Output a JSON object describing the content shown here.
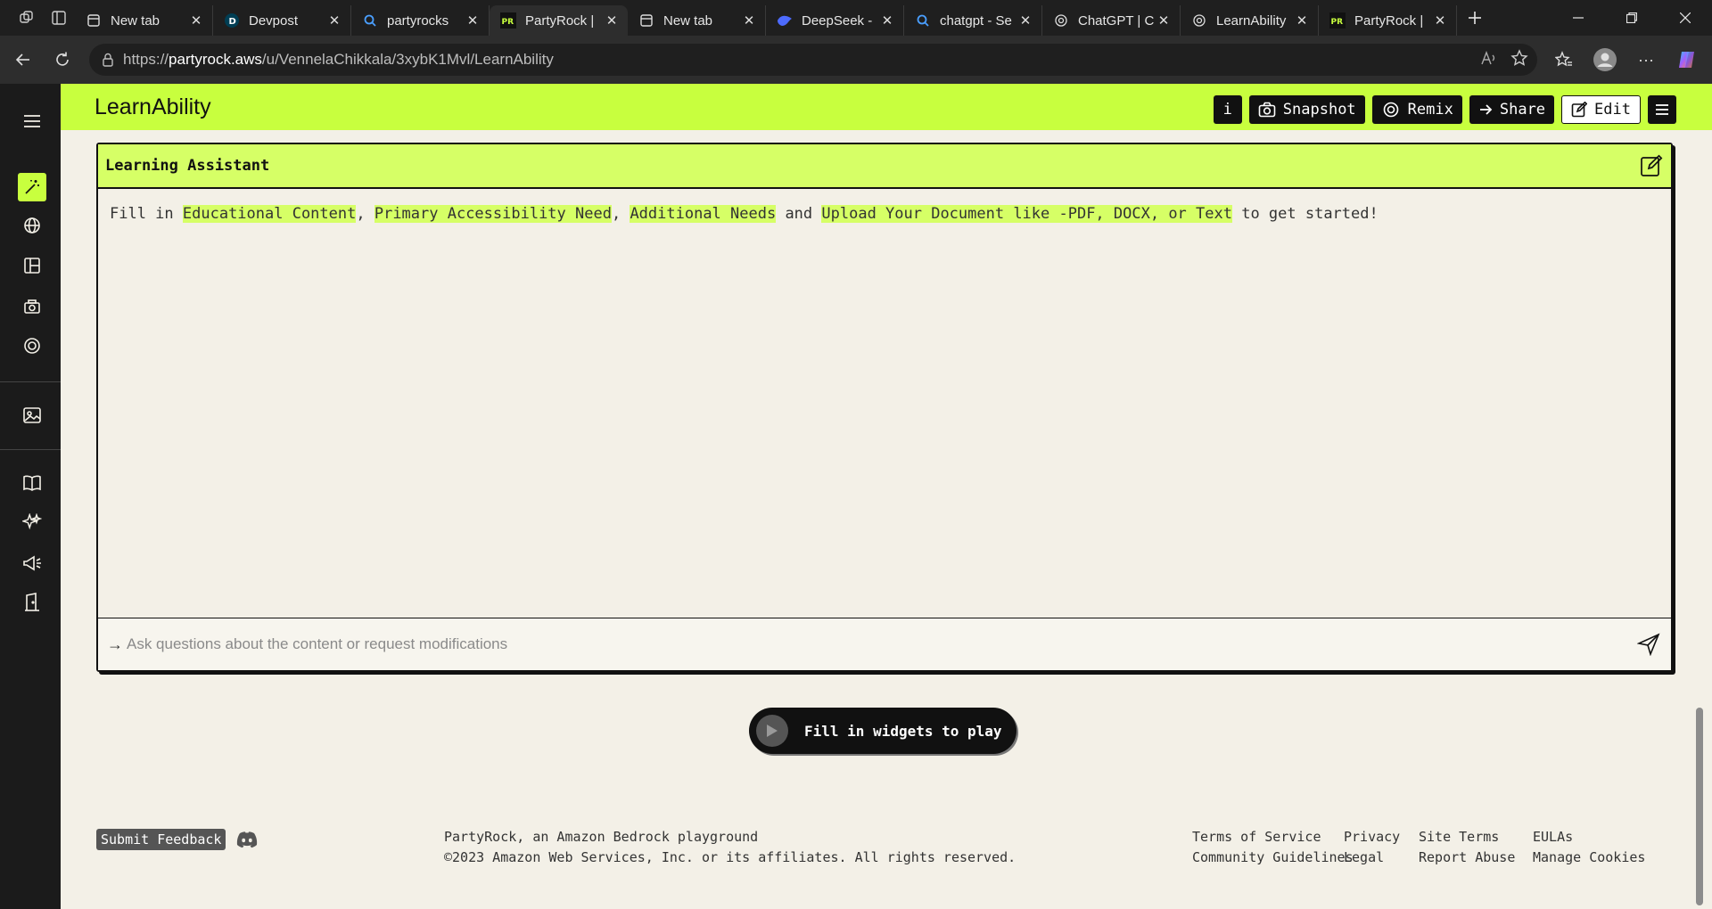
{
  "browser": {
    "tabs": [
      {
        "title": "New tab",
        "icon": "page-icon"
      },
      {
        "title": "Devpost",
        "icon": "devpost-icon"
      },
      {
        "title": "partyrocks",
        "icon": "search-icon"
      },
      {
        "title": "PartyRock |",
        "icon": "partyrock-icon",
        "active": true
      },
      {
        "title": "New tab",
        "icon": "page-icon"
      },
      {
        "title": "DeepSeek -",
        "icon": "deepseek-icon"
      },
      {
        "title": "chatgpt - Se",
        "icon": "search-icon"
      },
      {
        "title": "ChatGPT | C",
        "icon": "openai-icon"
      },
      {
        "title": "LearnAbility",
        "icon": "openai-icon"
      },
      {
        "title": "PartyRock |",
        "icon": "partyrock-icon"
      }
    ],
    "url_scheme": "https://",
    "url_host": "partyrock.aws",
    "url_path": "/u/VennelaChikkala/3xybK1Mvl/LearnAbility",
    "favicon_text": "PR"
  },
  "app": {
    "title": "LearnAbility",
    "actions": {
      "info": "i",
      "snapshot": "Snapshot",
      "remix": "Remix",
      "share": "Share",
      "edit": "Edit"
    }
  },
  "widget": {
    "title": "Learning Assistant",
    "body": {
      "prefix": "Fill in ",
      "field1": "Educational Content",
      "sep1": ", ",
      "field2": "Primary Accessibility Need",
      "sep2": ", ",
      "field3": "Additional Needs",
      "sep3": " and ",
      "field4": "Upload Your Document like -PDF, DOCX, or Text",
      "suffix": " to get started!"
    },
    "input_placeholder": "Ask questions about the content or request modifications"
  },
  "play_button": "Fill in widgets to play",
  "footer": {
    "feedback": "Submit Feedback",
    "line1": "PartyRock, an Amazon Bedrock playground",
    "line2": "©2023 Amazon Web Services, Inc. or its affiliates. All rights reserved.",
    "links": {
      "terms": "Terms of Service",
      "community": "Community Guidelines",
      "privacy": "Privacy",
      "legal": "Legal",
      "site_terms": "Site Terms",
      "report": "Report Abuse",
      "eulas": "EULAs",
      "cookies": "Manage Cookies"
    }
  },
  "colors": {
    "accent": "#c8ff3e",
    "sidebar": "#1b1b1b",
    "background": "#f3f0e7"
  }
}
